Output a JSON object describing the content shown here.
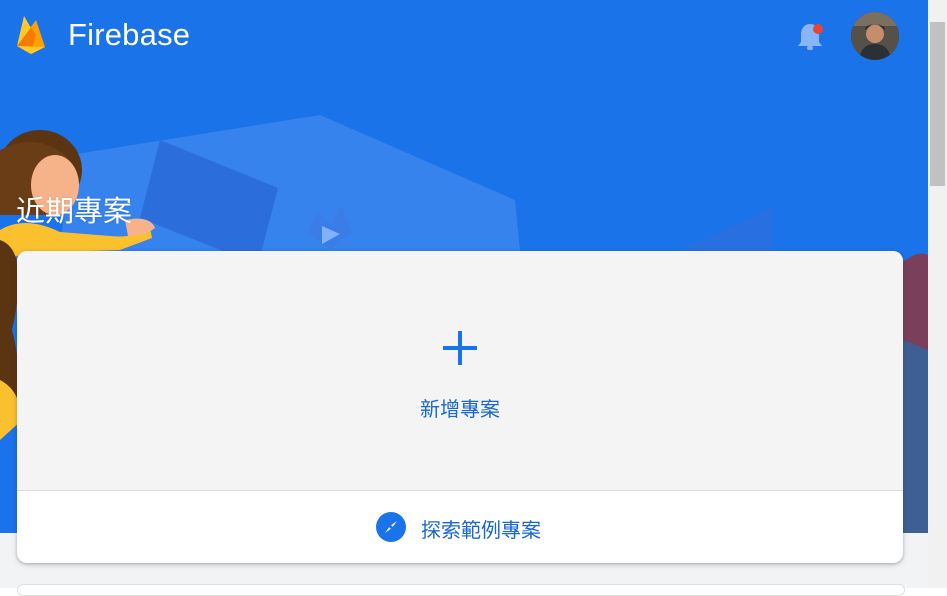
{
  "header": {
    "brand_name": "Firebase",
    "logo_icon": "firebase-flame-icon",
    "notification_icon": "bell-icon",
    "avatar_icon": "user-avatar"
  },
  "main": {
    "section_title": "近期專案",
    "add_project": {
      "icon": "plus-icon",
      "label": "新增專案"
    },
    "explore_demo": {
      "icon": "compass-icon",
      "label": "探索範例專案"
    }
  },
  "colors": {
    "brand_blue": "#1a73e8",
    "link_blue": "#1967d2",
    "notification_dot": "#ea4335",
    "flame_yellow": "#ffca28",
    "flame_orange": "#ffa000"
  }
}
